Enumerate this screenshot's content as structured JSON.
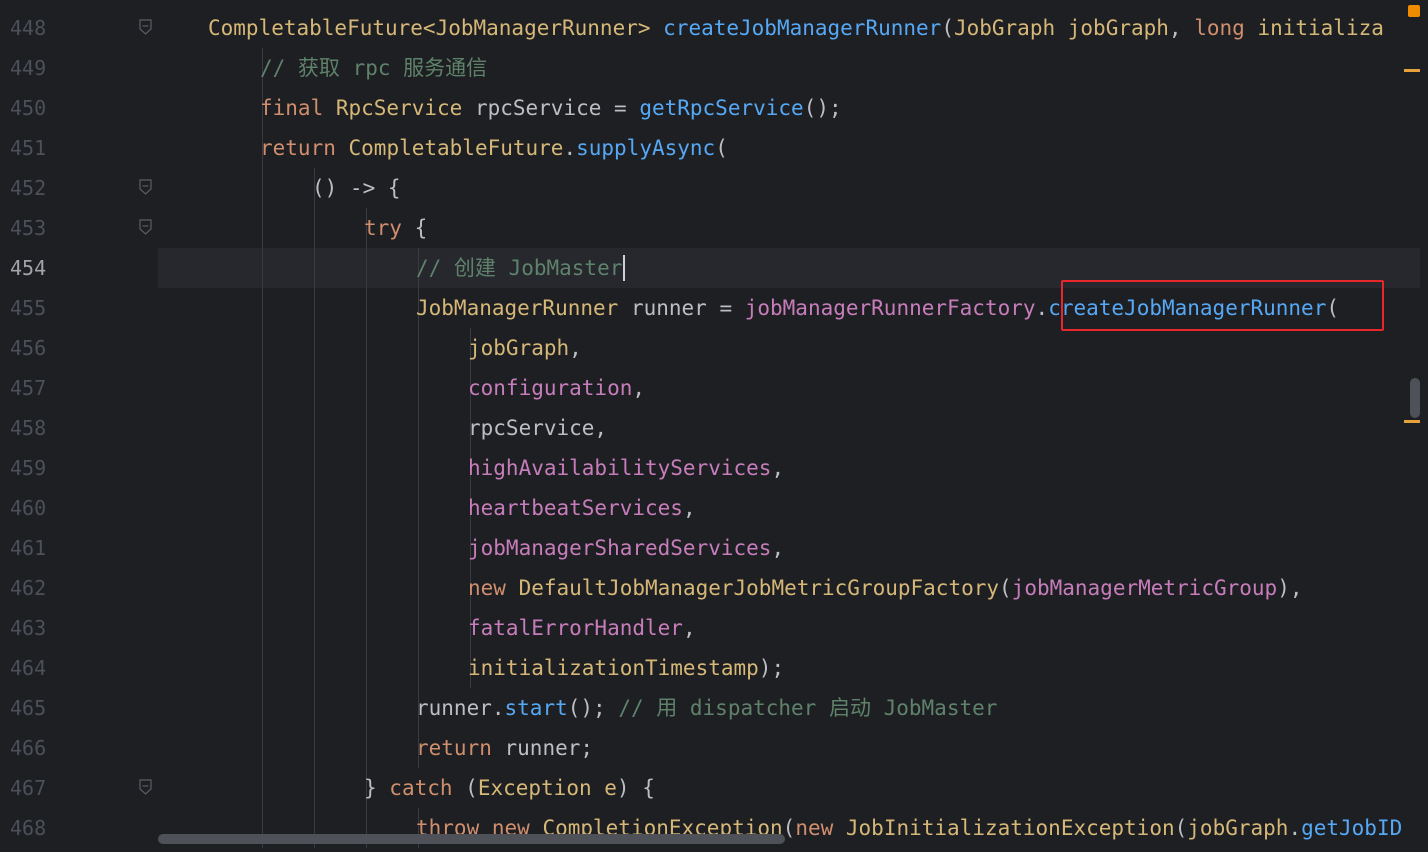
{
  "editor": {
    "current_line": 454,
    "lines": [
      {
        "num": "448",
        "indent": 1,
        "fold": true,
        "tokens": [
          {
            "t": "CompletableFuture<JobManagerRunner> ",
            "c": "tok-yellow"
          },
          {
            "t": "createJobManagerRunner",
            "c": "tok-method"
          },
          {
            "t": "(",
            "c": "tok-plain"
          },
          {
            "t": "JobGraph ",
            "c": "tok-yellow"
          },
          {
            "t": "jobGraph",
            "c": "tok-yellow"
          },
          {
            "t": ", ",
            "c": "tok-plain"
          },
          {
            "t": "long ",
            "c": "tok-keyword"
          },
          {
            "t": "initializa",
            "c": "tok-yellow"
          }
        ]
      },
      {
        "num": "449",
        "indent": 2,
        "fold": false,
        "tokens": [
          {
            "t": "// 获取 rpc 服务通信",
            "c": "tok-comment-cn"
          }
        ]
      },
      {
        "num": "450",
        "indent": 2,
        "fold": false,
        "tokens": [
          {
            "t": "final ",
            "c": "tok-keyword"
          },
          {
            "t": "RpcService ",
            "c": "tok-yellow"
          },
          {
            "t": "rpcService = ",
            "c": "tok-plain"
          },
          {
            "t": "getRpcService",
            "c": "tok-method"
          },
          {
            "t": "();",
            "c": "tok-plain"
          }
        ]
      },
      {
        "num": "451",
        "indent": 2,
        "fold": false,
        "tokens": [
          {
            "t": "return ",
            "c": "tok-keyword"
          },
          {
            "t": "CompletableFuture",
            "c": "tok-yellow"
          },
          {
            "t": ".",
            "c": "tok-plain"
          },
          {
            "t": "supplyAsync",
            "c": "tok-method"
          },
          {
            "t": "(",
            "c": "tok-plain"
          }
        ]
      },
      {
        "num": "452",
        "indent": 3,
        "fold": true,
        "tokens": [
          {
            "t": "() -> {",
            "c": "tok-plain"
          }
        ]
      },
      {
        "num": "453",
        "indent": 4,
        "fold": true,
        "tokens": [
          {
            "t": "try ",
            "c": "tok-keyword"
          },
          {
            "t": "{",
            "c": "tok-plain"
          }
        ]
      },
      {
        "num": "454",
        "indent": 5,
        "fold": false,
        "tokens": [
          {
            "t": "// 创建 JobMaster",
            "c": "tok-comment-cn"
          }
        ]
      },
      {
        "num": "455",
        "indent": 5,
        "fold": false,
        "tokens": [
          {
            "t": "JobManagerRunner ",
            "c": "tok-yellow"
          },
          {
            "t": "runner = ",
            "c": "tok-plain"
          },
          {
            "t": "jobManagerRunnerFactory",
            "c": "tok-field"
          },
          {
            "t": ".",
            "c": "tok-plain"
          },
          {
            "t": "createJobManagerRunner",
            "c": "tok-method"
          },
          {
            "t": "(",
            "c": "tok-plain"
          }
        ]
      },
      {
        "num": "456",
        "indent": 6,
        "fold": false,
        "tokens": [
          {
            "t": "jobGraph",
            "c": "tok-yellow"
          },
          {
            "t": ",",
            "c": "tok-plain"
          }
        ]
      },
      {
        "num": "457",
        "indent": 6,
        "fold": false,
        "tokens": [
          {
            "t": "configuration",
            "c": "tok-field"
          },
          {
            "t": ",",
            "c": "tok-plain"
          }
        ]
      },
      {
        "num": "458",
        "indent": 6,
        "fold": false,
        "tokens": [
          {
            "t": "rpcService,",
            "c": "tok-plain"
          }
        ]
      },
      {
        "num": "459",
        "indent": 6,
        "fold": false,
        "tokens": [
          {
            "t": "highAvailabilityServices",
            "c": "tok-field"
          },
          {
            "t": ",",
            "c": "tok-plain"
          }
        ]
      },
      {
        "num": "460",
        "indent": 6,
        "fold": false,
        "tokens": [
          {
            "t": "heartbeatServices",
            "c": "tok-field"
          },
          {
            "t": ",",
            "c": "tok-plain"
          }
        ]
      },
      {
        "num": "461",
        "indent": 6,
        "fold": false,
        "tokens": [
          {
            "t": "jobManagerSharedServices",
            "c": "tok-field"
          },
          {
            "t": ",",
            "c": "tok-plain"
          }
        ]
      },
      {
        "num": "462",
        "indent": 6,
        "fold": false,
        "tokens": [
          {
            "t": "new ",
            "c": "tok-keyword"
          },
          {
            "t": "DefaultJobManagerJobMetricGroupFactory",
            "c": "tok-yellow"
          },
          {
            "t": "(",
            "c": "tok-plain"
          },
          {
            "t": "jobManagerMetricGroup",
            "c": "tok-field"
          },
          {
            "t": "),",
            "c": "tok-plain"
          }
        ]
      },
      {
        "num": "463",
        "indent": 6,
        "fold": false,
        "tokens": [
          {
            "t": "fatalErrorHandler",
            "c": "tok-field"
          },
          {
            "t": ",",
            "c": "tok-plain"
          }
        ]
      },
      {
        "num": "464",
        "indent": 6,
        "fold": false,
        "tokens": [
          {
            "t": "initializationTimestamp",
            "c": "tok-yellow"
          },
          {
            "t": ");",
            "c": "tok-plain"
          }
        ]
      },
      {
        "num": "465",
        "indent": 5,
        "fold": false,
        "tokens": [
          {
            "t": "runner.",
            "c": "tok-plain"
          },
          {
            "t": "start",
            "c": "tok-method"
          },
          {
            "t": "(); ",
            "c": "tok-plain"
          },
          {
            "t": "// 用 dispatcher 启动 JobMaster",
            "c": "tok-comment-cn"
          }
        ]
      },
      {
        "num": "466",
        "indent": 5,
        "fold": false,
        "tokens": [
          {
            "t": "return ",
            "c": "tok-keyword"
          },
          {
            "t": "runner;",
            "c": "tok-plain"
          }
        ]
      },
      {
        "num": "467",
        "indent": 4,
        "fold": true,
        "tokens": [
          {
            "t": "} ",
            "c": "tok-plain"
          },
          {
            "t": "catch ",
            "c": "tok-keyword"
          },
          {
            "t": "(",
            "c": "tok-plain"
          },
          {
            "t": "Exception ",
            "c": "tok-yellow"
          },
          {
            "t": "e",
            "c": "tok-yellow"
          },
          {
            "t": ") {",
            "c": "tok-plain"
          }
        ]
      },
      {
        "num": "468",
        "indent": 5,
        "fold": false,
        "tokens": [
          {
            "t": "throw ",
            "c": "tok-keyword"
          },
          {
            "t": "new ",
            "c": "tok-keyword"
          },
          {
            "t": "CompletionException",
            "c": "tok-yellow"
          },
          {
            "t": "(",
            "c": "tok-plain"
          },
          {
            "t": "new ",
            "c": "tok-keyword"
          },
          {
            "t": "JobInitializationException",
            "c": "tok-yellow"
          },
          {
            "t": "(",
            "c": "tok-plain"
          },
          {
            "t": "jobGraph",
            "c": "tok-yellow"
          },
          {
            "t": ".",
            "c": "tok-plain"
          },
          {
            "t": "getJobID",
            "c": "tok-method"
          }
        ]
      }
    ]
  },
  "highlight": {
    "target": "createJobManagerRunner("
  },
  "colors": {
    "background": "#1e1f22",
    "current_line": "#26282e",
    "keyword": "#cf8e6d",
    "comment": "#5f826b",
    "method": "#56a8f5",
    "field": "#c77dbb",
    "highlight_box": "#e8262c",
    "marker": "#e5a23d"
  }
}
